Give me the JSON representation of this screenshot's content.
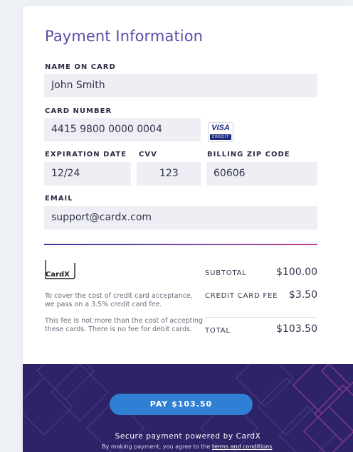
{
  "form": {
    "title": "Payment Information",
    "name_label": "NAME ON CARD",
    "name_value": "John Smith",
    "card_label": "CARD NUMBER",
    "card_value": "4415 9800 0000 0004",
    "card_brand": "VISA",
    "card_brand_sub": "CREDIT",
    "exp_label": "EXPIRATION DATE",
    "exp_value": "12/24",
    "cvv_label": "CVV",
    "cvv_value": "123",
    "zip_label": "BILLING ZIP CODE",
    "zip_value": "60606",
    "email_label": "EMAIL",
    "email_value": "support@cardx.com"
  },
  "summary": {
    "logo_text": "CardX",
    "note1": "To cover the cost of credit card acceptance, we pass on a 3.5% credit card fee.",
    "note2": "This fee is not more than the cost of accepting these cards. There is no fee for debit cards.",
    "subtotal_label": "SUBTOTAL",
    "subtotal_value": "$100.00",
    "fee_label": "CREDIT CARD FEE",
    "fee_value": "$3.50",
    "total_label": "TOTAL",
    "total_value": "$103.50"
  },
  "footer": {
    "pay_label": "PAY $103.50",
    "secure_text": "Secure payment powered by CardX",
    "agree_prefix": "By making payment, you agree to the ",
    "terms_link": "terms and conditions",
    "agree_suffix": "."
  },
  "colors": {
    "title": "#5a4aa6",
    "field_bg": "#eeeff5",
    "footer_bg": "#2e2366",
    "pay_button": "#2f7fd4",
    "divider_start": "#3e3a9e",
    "divider_end": "#c03a7a"
  }
}
